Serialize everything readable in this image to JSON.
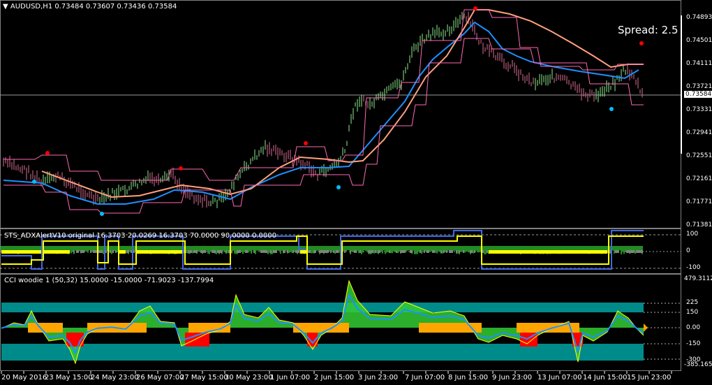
{
  "main": {
    "title": "AUDUSD,H1  0.73484 0.73607 0.73436 0.73584",
    "spread": "Spread: 2.5",
    "price_ticks": [
      "0.74893",
      "0.74501",
      "0.74111",
      "0.73721",
      "0.73331",
      "0.72941",
      "0.72551",
      "0.72161",
      "0.71771",
      "0.71381"
    ],
    "current_price": "0.73584"
  },
  "adx": {
    "title": "STS_ADXAlertV10 original 16.3703 20.0269 16.3703 70.0000 90.0000 0.0000",
    "ticks": [
      "100",
      "0",
      "-100"
    ]
  },
  "cci": {
    "title": "CCI woodie 1 (50,32) 15.0000 -15.0000 -71.9023 -137.7994",
    "ticks": [
      "479.3112",
      "225",
      "150",
      "0.00",
      "-150",
      "-300",
      "-385.1651"
    ]
  },
  "time_axis": [
    "20 May 2016",
    "23 May 15:00",
    "24 May 23:00",
    "26 May 07:00",
    "27 May 15:00",
    "30 May 23:00",
    "1 Jun 07:00",
    "2 Jun 15:00",
    "3 Jun 23:00",
    "7 Jun 07:00",
    "8 Jun 15:00",
    "9 Jun 23:00",
    "13 Jun 07:00",
    "14 Jun 15:00",
    "15 Jun 23:00"
  ],
  "colors": {
    "background": "#000000",
    "bull_bar": "#90ee90",
    "bear_bar": "#db7093",
    "ma_blue": "#1e90ff",
    "ma_orange": "#ffa07a",
    "channel_line": "#ff69b4",
    "adx_blue": "#4169e1",
    "adx_yellow": "#ffff00",
    "cci_green": "#32cd32",
    "cci_orange": "#ffa500",
    "cci_red": "#ff0000",
    "cci_teal": "#008b8b",
    "signal_red": "#ff0000",
    "signal_blue": "#00bfff"
  }
}
